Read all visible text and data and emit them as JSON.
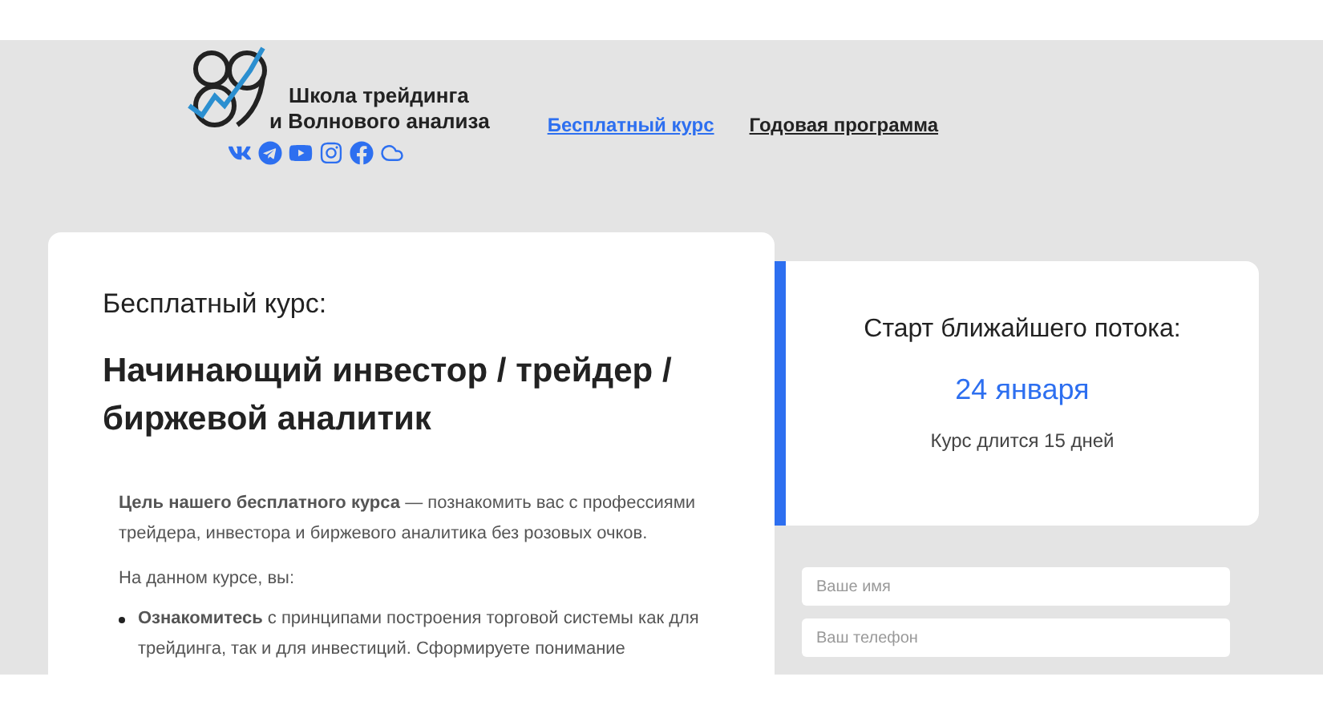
{
  "header": {
    "logo_text_lines": [
      "Школа трейдинга",
      "и Волнового анализа"
    ],
    "nav": [
      {
        "label": "Бесплатный курс",
        "selected": true
      },
      {
        "label": "Годовая программа",
        "selected": false
      }
    ],
    "social": [
      {
        "kind": "vk"
      },
      {
        "kind": "telegram"
      },
      {
        "kind": "youtube"
      },
      {
        "kind": "instagram"
      },
      {
        "kind": "facebook"
      },
      {
        "kind": "cloud"
      }
    ]
  },
  "course_card": {
    "eyebrow": "Бесплатный курс:",
    "title": "Начинающий инвестор / трейдер / биржевой аналитик",
    "intro": "**Цель нашего бесплатного курса** — познакомить вас с профессиями трейдера, инвестора и биржевого аналитика без розовых очков.",
    "lead": "На данном курсе, вы:",
    "bullets": [
      "**Ознакомитесь** с принципами построения торговой системы как для трейдинга, так и для инвестиций. Сформируете понимание"
    ]
  },
  "start_card": {
    "heading": "Старт ближайшего потока:",
    "date": "24 января",
    "duration": "Курс длится 15 дней"
  },
  "form": {
    "fields": [
      {
        "placeholder": "Ваше имя"
      },
      {
        "placeholder": "Ваш телефон"
      }
    ]
  }
}
